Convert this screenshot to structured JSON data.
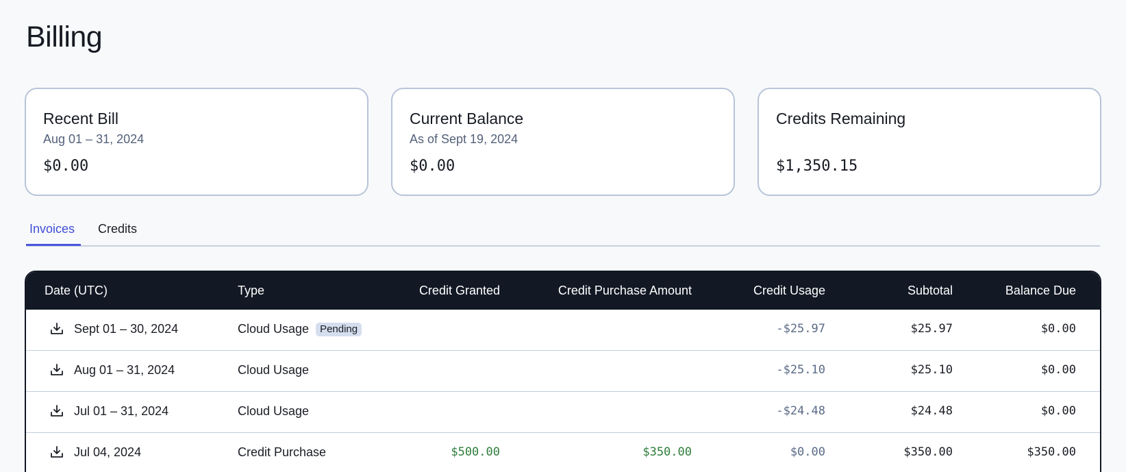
{
  "page": {
    "title": "Billing"
  },
  "cards": [
    {
      "title": "Recent Bill",
      "subtitle": "Aug 01 – 31, 2024",
      "value": "$0.00"
    },
    {
      "title": "Current Balance",
      "subtitle": "As of Sept 19, 2024",
      "value": "$0.00"
    },
    {
      "title": "Credits Remaining",
      "subtitle": "",
      "value": "$1,350.15"
    }
  ],
  "tabs": [
    {
      "label": "Invoices",
      "active": true
    },
    {
      "label": "Credits",
      "active": false
    }
  ],
  "table": {
    "columns": [
      "Date (UTC)",
      "Type",
      "Credit Granted",
      "Credit Purchase Amount",
      "Credit Usage",
      "Subtotal",
      "Balance Due"
    ],
    "rows": [
      {
        "date": "Sept 01 – 30, 2024",
        "type": "Cloud Usage",
        "badge": "Pending",
        "credit_granted": "",
        "credit_purchase": "",
        "credit_usage": "-$25.97",
        "subtotal": "$25.97",
        "balance_due": "$0.00"
      },
      {
        "date": "Aug 01 – 31, 2024",
        "type": "Cloud Usage",
        "badge": "",
        "credit_granted": "",
        "credit_purchase": "",
        "credit_usage": "-$25.10",
        "subtotal": "$25.10",
        "balance_due": "$0.00"
      },
      {
        "date": "Jul 01 – 31, 2024",
        "type": "Cloud Usage",
        "badge": "",
        "credit_granted": "",
        "credit_purchase": "",
        "credit_usage": "-$24.48",
        "subtotal": "$24.48",
        "balance_due": "$0.00"
      },
      {
        "date": "Jul 04, 2024",
        "type": "Credit Purchase",
        "badge": "",
        "credit_granted": "$500.00",
        "credit_purchase": "$350.00",
        "credit_usage": "$0.00",
        "subtotal": "$350.00",
        "balance_due": "$350.00"
      }
    ],
    "row_icon": "download-icon"
  },
  "colors": {
    "accent": "#4957dc",
    "header_bg": "#121824",
    "positive": "#2e7d3a",
    "negative": "#5a6a86",
    "badge_bg": "#d5deee"
  }
}
